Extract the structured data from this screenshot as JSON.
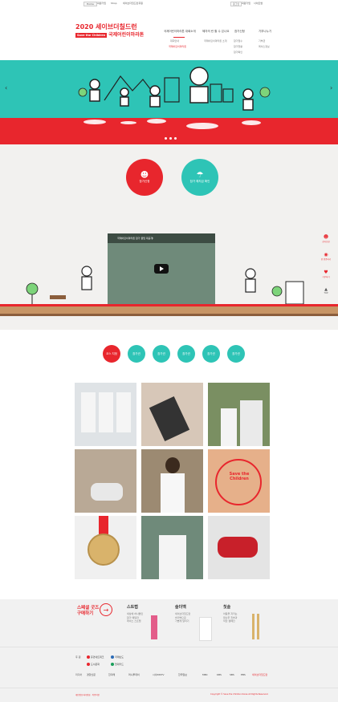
{
  "colors": {
    "brand_red": "#e8262d",
    "teal": "#2ec4b6",
    "bg_gray": "#f2f1ef"
  },
  "utility": {
    "items": [
      "Home",
      "회원가입",
      "Shop",
      "세이브더칠드런후원"
    ],
    "right": [
      "로그인",
      "회원가입",
      "사이트맵"
    ]
  },
  "header": {
    "logo_year": "2020 세이브더칠드런",
    "logo_badge": "Save the Children",
    "logo_title": "국제어린이마라톤",
    "nav": [
      "국제어린이마라톤 대회소개",
      "혜자의 런 할 수 있나요",
      "참가신청",
      "기부나누기"
    ],
    "subnav": [
      "대회안내",
      "국제어린이마라톤 소개",
      "참가접수",
      "참가현황",
      "참가확인",
      "기부금",
      "레이스정보"
    ],
    "subnav_active": "국제어린이마라톤"
  },
  "hero": {
    "prev": "‹",
    "next": "›"
  },
  "quick": {
    "apply_label": "참가신청",
    "donate_label": "참가 예치금 확인"
  },
  "video": {
    "title": "국제어린이마라톤 참가 꿀팁 대공개!"
  },
  "side_menu": [
    "참가신청",
    "런 인증하기",
    "기부하기",
    "TOP"
  ],
  "tabs": [
    "코스 지정",
    "참가권",
    "참가권",
    "참가권",
    "참가권",
    "참가권"
  ],
  "shop": {
    "title": "스페셜 굿즈\n구매하기",
    "arrow": "→",
    "products": [
      {
        "name": "스트랩",
        "desc": "세상에 하나뿐인\n참가 메달과\n레이스 스트랩"
      },
      {
        "name": "슬더백",
        "desc": "세이브더칠드런\n슬더백으로\n가볍게 달리기"
      },
      {
        "name": "칫솔",
        "desc": "아동을 지키는\n대나무 칫솔과\n착한 캠페인"
      }
    ]
  },
  "sponsors": {
    "row1_label": "후 원",
    "row1": [
      "휴먼네트워크",
      "국제반도",
      "도서문화",
      "현대카드"
    ],
    "row2_label": "미디어",
    "row2": [
      "경향신문",
      "한겨레",
      "머니투데이",
      "시사INSTV",
      "한국일보",
      "MBC",
      "KBS",
      "SBS",
      "EBS",
      "세이브더칠드런"
    ]
  },
  "footer": {
    "left": "개인정보처리방침 · 이용약관",
    "right": "Copyright © Save the Children Korea All Rights Reserved."
  }
}
